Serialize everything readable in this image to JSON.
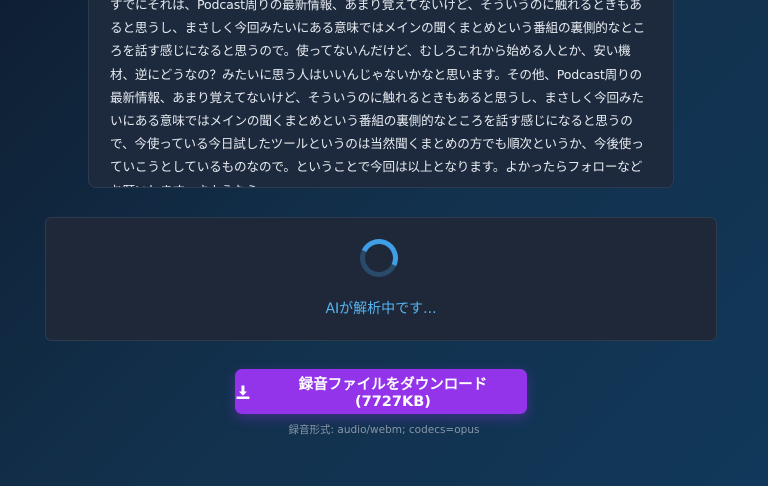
{
  "transcript": {
    "text": "すでにそれは、Podcast周りの最新情報、あまり覚えてないけど、そういうのに触れるときもあると思うし、まさしく今回みたいにある意味ではメインの聞くまとめという番組の裏側的なところを話す感じになると思うので。使ってないんだけど、むしろこれから始める人とか、安い機材、逆にどうなの？みたいに思う人はいいんじゃないかなと思います。その他、Podcast周りの最新情報、あまり覚えてないけど、そういうのに触れるときもあると思うし、まさしく今回みたいにある意味ではメインの聞くまとめという番組の裏側的なところを話す感じになると思うので、今使っている今日試したツールというのは当然聞くまとめの方でも順次というか、今後使っていこうとしているものなので。ということで今回は以上となります。よかったらフォローなどお願いします。さようなら。"
  },
  "status": {
    "message": "AIが解析中です..."
  },
  "download": {
    "icon": "download-icon",
    "label": "録音ファイルをダウンロード (7727KB)"
  },
  "format": {
    "note": "録音形式: audio/webm; codecs=opus"
  },
  "colors": {
    "accent": "#9333ea",
    "spinner": "#3f9ee6",
    "status_text": "#56b4f2"
  }
}
